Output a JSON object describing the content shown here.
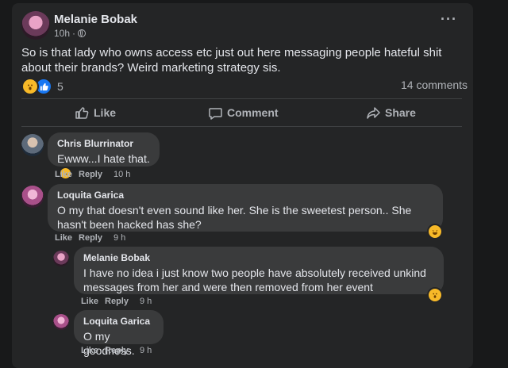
{
  "post": {
    "author": "Melanie Bobak",
    "time": "10h",
    "dot": "·",
    "more": "···",
    "text": "So is that lady who owns access etc just out here messaging people hateful shit about their brands? Weird marketing strategy sis.",
    "reaction_count": "5",
    "comment_count": "14 comments"
  },
  "actions": {
    "like": "Like",
    "comment": "Comment",
    "share": "Share"
  },
  "comments": [
    {
      "author": "Chris Blurrinator",
      "text": "Ewww...I hate that.",
      "like": "Like",
      "reply": "Reply",
      "time": "10 h"
    },
    {
      "author": "Loquita Garica",
      "text": "O my that doesn't even sound like her. She is the sweetest person.. She hasn't been hacked has she?",
      "like": "Like",
      "reply": "Reply",
      "time": "9 h"
    },
    {
      "author": "Melanie Bobak",
      "text": "I have no idea i just know two people have absolutely received unkind messages from her and were then removed from her event",
      "like": "Like",
      "reply": "Reply",
      "time": "9 h"
    },
    {
      "author": "Loquita Garica",
      "text": "O my goodness.",
      "like": "Like",
      "reply": "Reply",
      "time": "9 h"
    }
  ],
  "icons": [
    "globe-icon",
    "more-icon",
    "wow-reaction-icon",
    "like-reaction-icon",
    "like-icon",
    "comment-icon",
    "share-icon"
  ],
  "colors": {
    "background": "#18191a",
    "card": "#242526",
    "bubble": "#3a3b3c",
    "text": "#e4e6eb",
    "secondary": "#b0b3b8",
    "like_blue": "#1877f2",
    "emoji_yellow": "#f7b928"
  }
}
